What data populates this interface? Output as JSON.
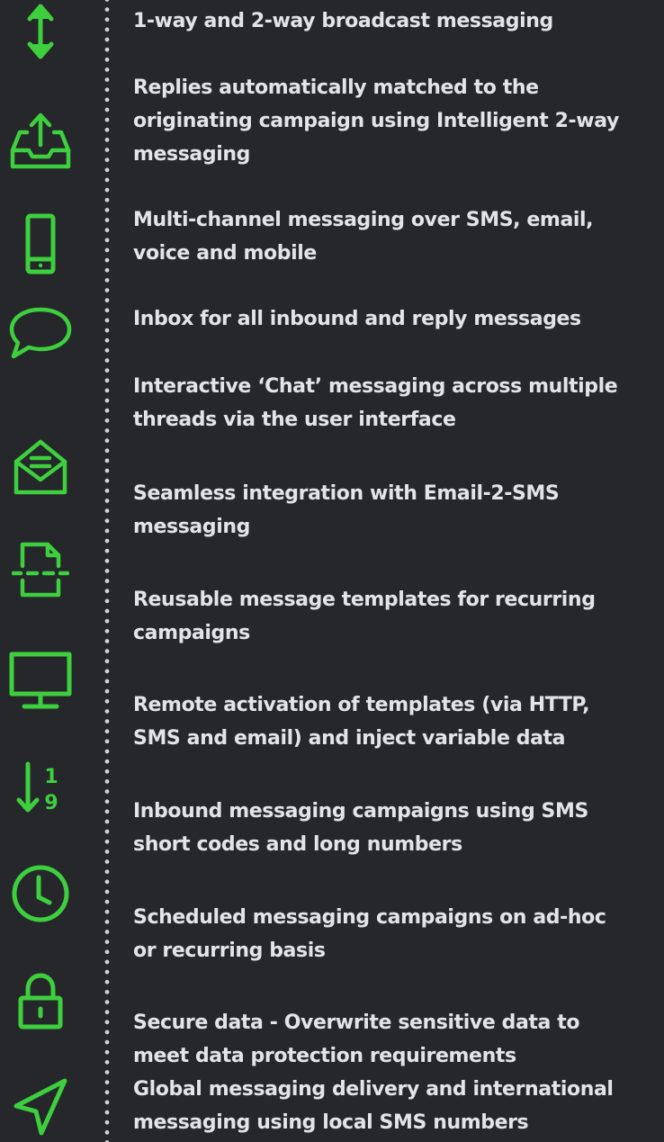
{
  "accent_color": "#3ecf3e",
  "background_color": "#25272a",
  "features": [
    {
      "icon": "vertical-arrows-icon",
      "lines": [
        "1-way and 2-way broadcast messaging"
      ]
    },
    {
      "icon": "inbox-upload-icon",
      "lines": [
        "Replies automatically matched to the",
        "originating campaign using Intelligent 2-way",
        "messaging"
      ]
    },
    {
      "icon": "mobile-phone-icon",
      "lines": [
        "Multi-channel messaging over SMS, email,",
        "voice and mobile"
      ]
    },
    {
      "icon": "chat-bubble-icon",
      "lines": [
        "Inbox for all inbound and reply messages"
      ]
    },
    {
      "icon": "envelope-open-icon",
      "lines": [
        "Interactive ‘Chat’ messaging across multiple",
        "threads via the user interface"
      ]
    },
    {
      "icon": "document-split-icon",
      "lines": [
        "Seamless integration with Email-2-SMS",
        "messaging"
      ]
    },
    {
      "icon": "monitor-icon",
      "lines": [
        "Reusable message templates for recurring",
        "campaigns"
      ]
    },
    {
      "icon": "sort-numeric-icon",
      "lines": [
        "Remote activation of templates (via HTTP,",
        "SMS and email) and inject variable data"
      ]
    },
    {
      "icon": "clock-icon",
      "lines": [
        "Inbound messaging campaigns using SMS",
        "short codes and long numbers"
      ]
    },
    {
      "icon": "padlock-icon",
      "lines": [
        "Scheduled messaging campaigns on ad-hoc",
        "or recurring basis"
      ]
    },
    {
      "icon": "navigation-arrow-icon",
      "lines": [
        "Secure data - Overwrite sensitive data to",
        "meet data protection requirements"
      ]
    },
    {
      "icon": "",
      "lines": [
        "Global messaging delivery and international",
        "messaging using local SMS numbers"
      ]
    }
  ]
}
